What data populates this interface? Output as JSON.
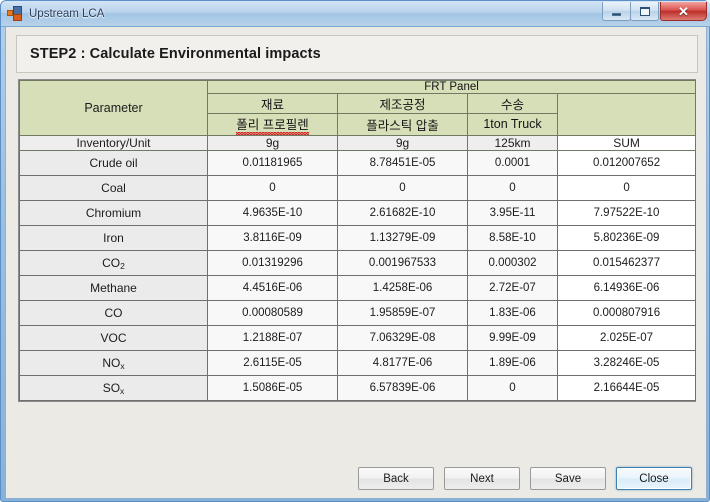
{
  "window": {
    "title": "Upstream LCA",
    "icon": "application-icon",
    "controls": {
      "minimize": "minimize-button",
      "maximize": "maximize-button",
      "close_glyph": "✕"
    }
  },
  "step_header": {
    "title": "STEP2 : Calculate Environmental impacts"
  },
  "table": {
    "parameter_label": "Parameter",
    "group_label": "FRT Panel",
    "process_labels": [
      "재료",
      "제조공정",
      "수송",
      ""
    ],
    "detail_labels": [
      "폴리 프로필렌",
      "플라스틱 압출",
      "1ton Truck",
      ""
    ],
    "unit_row_label": "Inventory/Unit",
    "units": [
      "9g",
      "9g",
      "125km",
      "SUM"
    ],
    "rows": [
      {
        "name": "Crude oil",
        "name_html": "Crude oil",
        "values": [
          "0.01181965",
          "8.78451E-05",
          "0.0001",
          "0.012007652"
        ]
      },
      {
        "name": "Coal",
        "name_html": "Coal",
        "values": [
          "0",
          "0",
          "0",
          "0"
        ]
      },
      {
        "name": "Chromium",
        "name_html": "Chromium",
        "values": [
          "4.9635E-10",
          "2.61682E-10",
          "3.95E-11",
          "7.97522E-10"
        ]
      },
      {
        "name": "Iron",
        "name_html": "Iron",
        "values": [
          "3.8116E-09",
          "1.13279E-09",
          "8.58E-10",
          "5.80236E-09"
        ]
      },
      {
        "name": "CO2",
        "name_html": "CO<sub>2</sub>",
        "values": [
          "0.01319296",
          "0.001967533",
          "0.000302",
          "0.015462377"
        ]
      },
      {
        "name": "Methane",
        "name_html": "Methane",
        "values": [
          "4.4516E-06",
          "1.4258E-06",
          "2.72E-07",
          "6.14936E-06"
        ]
      },
      {
        "name": "CO",
        "name_html": "CO",
        "values": [
          "0.00080589",
          "1.95859E-07",
          "1.83E-06",
          "0.000807916"
        ]
      },
      {
        "name": "VOC",
        "name_html": "VOC",
        "values": [
          "1.2188E-07",
          "7.06329E-08",
          "9.99E-09",
          "2.025E-07"
        ]
      },
      {
        "name": "NOx",
        "name_html": "NO<sub>x</sub>",
        "values": [
          "2.6115E-05",
          "4.8177E-06",
          "1.89E-06",
          "3.28246E-05"
        ]
      },
      {
        "name": "SOx",
        "name_html": "SO<sub>x</sub>",
        "values": [
          "1.5086E-05",
          "6.57839E-06",
          "0",
          "2.16644E-05"
        ]
      }
    ]
  },
  "footer": {
    "buttons": [
      {
        "label": "Back",
        "focused": false
      },
      {
        "label": "Next",
        "focused": false
      },
      {
        "label": "Save",
        "focused": false
      },
      {
        "label": "Close",
        "focused": true
      }
    ]
  },
  "colors": {
    "header_green": "#d7dfb9",
    "unit_row_gray": "#eeeeee",
    "name_col_gray": "#ebebeb",
    "data_cell": "#f8f8f8",
    "grid_line": "#6f6f6f",
    "close_red": "#d9534f",
    "focus_blue": "#3c7fb1"
  }
}
